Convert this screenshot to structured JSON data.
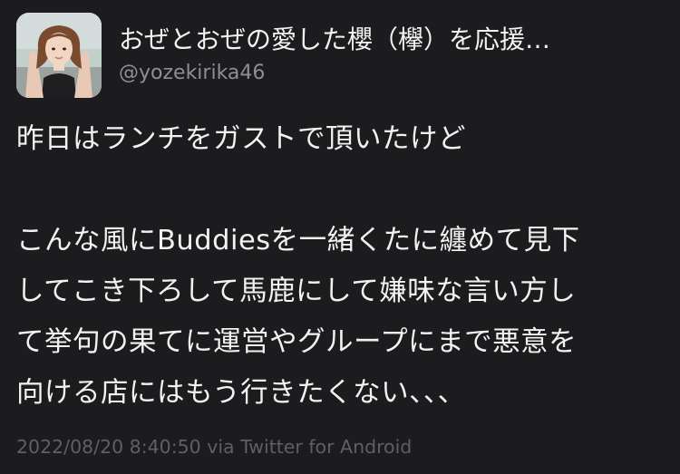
{
  "user": {
    "display_name": "おぜとおぜの愛した櫻（欅）を応援…",
    "handle": "@yozekirika46"
  },
  "tweet": {
    "lines": [
      "昨日はランチをガストで頂いたけど",
      "",
      "こんな風にBuddiesを一緒くたに纏めて見下",
      "してこき下ろして馬鹿にして嫌味な言い方し",
      "て挙句の果てに運営やグループにまで悪意を",
      "向ける店にはもう行きたくない、、、"
    ],
    "meta": "2022/08/20 8:40:50 via Twitter for Android"
  },
  "colors": {
    "background": "#1c1c1e",
    "text": "#f2f2f2",
    "secondary": "#8e8e93",
    "meta": "#5f5f64"
  }
}
